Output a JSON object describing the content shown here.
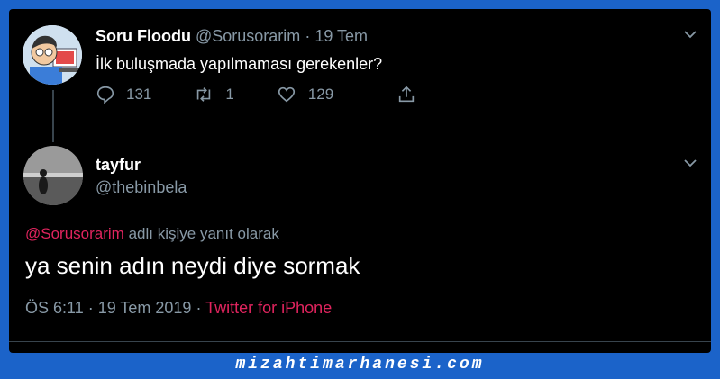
{
  "original_tweet": {
    "name": "Soru Floodu",
    "handle": "@Sorusorarim",
    "separator": "·",
    "date": "19 Tem",
    "text": "İlk buluşmada yapılmaması gerekenler?",
    "replies": "131",
    "retweets": "1",
    "likes": "129"
  },
  "reply_tweet": {
    "name": "tayfur",
    "handle": "@thebinbela",
    "reply_to_user": "@Sorusorarim",
    "reply_to_suffix": "adlı kişiye yanıt olarak",
    "text": "ya senin adın neydi diye sormak",
    "time": "ÖS 6:11 · 19 Tem 2019 ·",
    "source": "Twitter for iPhone"
  },
  "watermark": "mizahtimarhanesi.com",
  "colors": {
    "page_bg": "#1b63c9",
    "card_bg": "#000000",
    "muted": "#8899a6",
    "link": "#e0245e"
  },
  "icons": [
    "reply-icon",
    "retweet-icon",
    "like-icon",
    "share-icon",
    "chevron-down-icon"
  ]
}
